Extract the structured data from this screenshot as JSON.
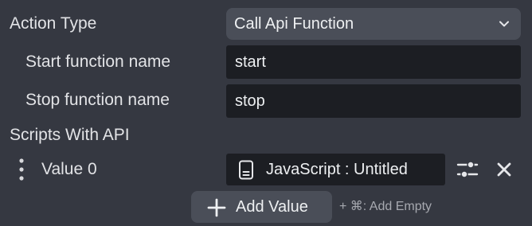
{
  "action_type": {
    "label": "Action Type",
    "selected": "Call Api Function",
    "chevron_icon": "chevron-down-icon"
  },
  "start_function": {
    "label": "Start function name",
    "value": "start"
  },
  "stop_function": {
    "label": "Stop function name",
    "value": "stop"
  },
  "scripts": {
    "label": "Scripts With API",
    "items": [
      {
        "name": "Value 0",
        "value": "JavaScript : Untitled",
        "icon": "document-icon",
        "settings_icon": "sliders-icon",
        "remove_icon": "close-icon",
        "drag_icon": "drag-handle-icon"
      }
    ],
    "add_button": "Add Value",
    "add_hint": "+ ⌘: Add Empty"
  },
  "colors": {
    "background": "#353841",
    "field": "#1c1e23",
    "button": "#4a4e58",
    "text": "#e2e3e6",
    "hint": "#a7a9b0"
  }
}
